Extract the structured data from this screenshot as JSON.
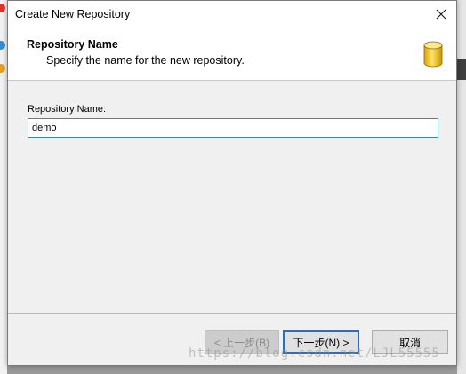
{
  "window": {
    "title": "Create New Repository"
  },
  "header": {
    "title": "Repository Name",
    "subtitle": "Specify the name for the new repository."
  },
  "form": {
    "repository_name_label": "Repository Name:",
    "repository_name_value": "demo"
  },
  "buttons": {
    "back_label": "< 上一步(B)",
    "next_label": "下一步(N) >",
    "cancel_label": "取消"
  },
  "watermark": {
    "text": "https://blog.csdn.net/LJL55555"
  },
  "icons": {
    "close": "close-icon",
    "header": "database-icon"
  },
  "colors": {
    "focus_border": "#3a86c8",
    "default_button_border": "#2a6fb8",
    "database_icon": "#f2c21a"
  }
}
